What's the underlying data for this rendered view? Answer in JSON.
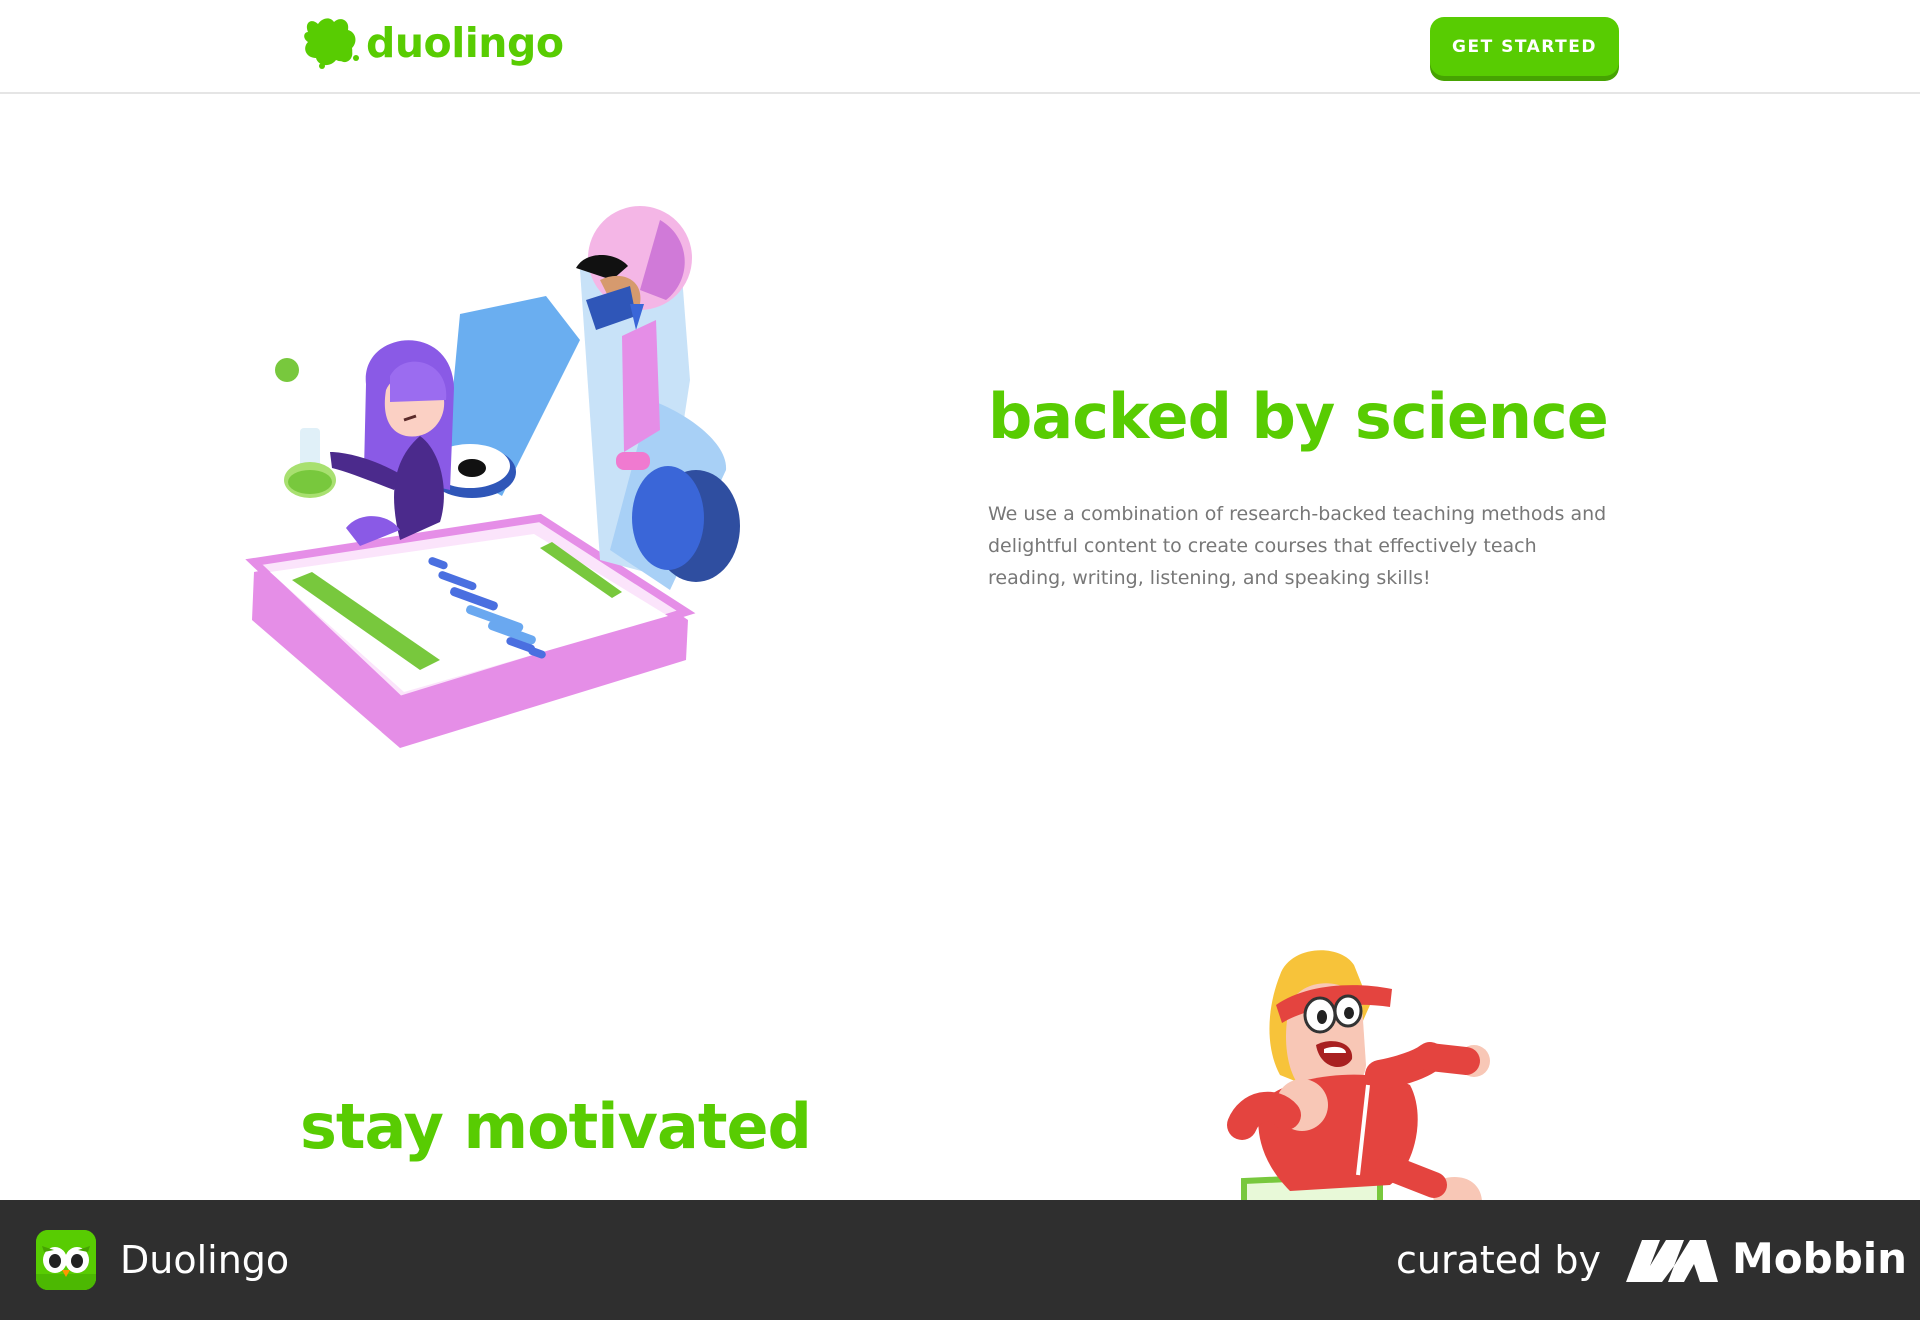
{
  "header": {
    "logo_text": "duolingo",
    "cta_label": "GET STARTED"
  },
  "science": {
    "title": "backed by science",
    "body": "We use a combination of research-backed teaching methods and delightful content to create courses that effectively teach reading, writing, listening, and speaking skills!"
  },
  "motivated": {
    "title": "stay motivated"
  },
  "footer_bar": {
    "app_name": "Duolingo",
    "curated_label": "curated by",
    "brand_name": "Mobbin"
  },
  "colors": {
    "brand_green": "#58cc02",
    "brand_green_shadow": "#46a302",
    "body_text": "#777777",
    "footer_bg": "#2f2f2f"
  },
  "icons": [
    "duo-owl-logo-icon",
    "science-illustration",
    "runner-illustration",
    "duolingo-app-icon",
    "mobbin-logo-icon"
  ]
}
